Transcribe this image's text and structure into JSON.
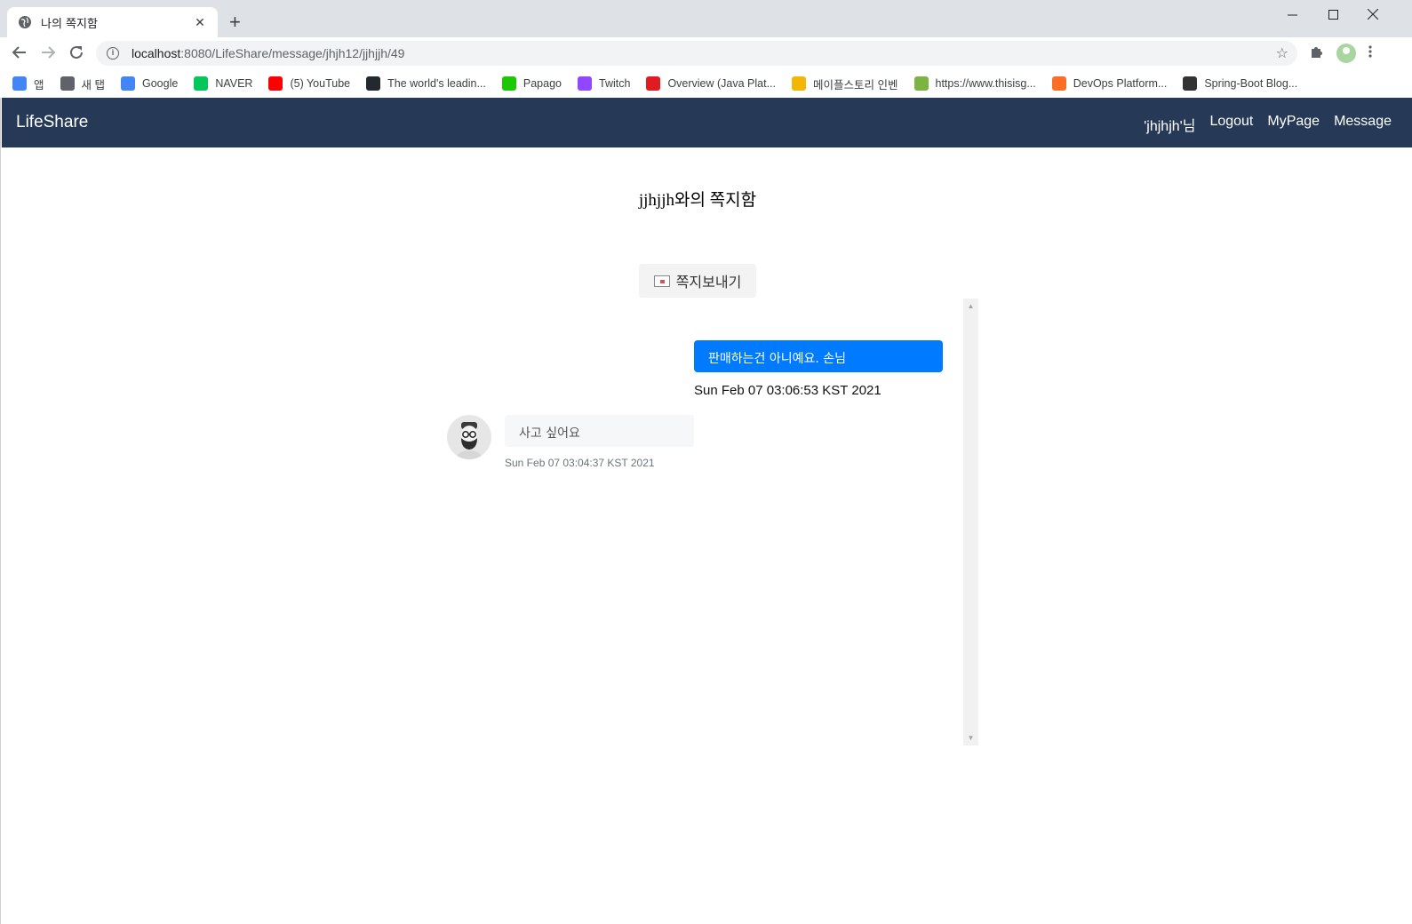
{
  "browser": {
    "tab_title": "나의 쪽지함",
    "tab_close": "✕",
    "new_tab": "+",
    "url_host": "localhost",
    "url_path": ":8080/LifeShare/message/jhjh12/jjhjjh/49",
    "bookmarks": [
      {
        "label": "앱",
        "icon": "apps-grid-icon",
        "color": "#4285f4"
      },
      {
        "label": "새 탭",
        "icon": "globe-icon",
        "color": "#5f6368"
      },
      {
        "label": "Google",
        "icon": "google-icon",
        "color": "#4285f4"
      },
      {
        "label": "NAVER",
        "icon": "naver-icon",
        "color": "#03c75a"
      },
      {
        "label": "(5) YouTube",
        "icon": "youtube-icon",
        "color": "#ff0000"
      },
      {
        "label": "The world's leadin...",
        "icon": "github-icon",
        "color": "#24292e"
      },
      {
        "label": "Papago",
        "icon": "papago-icon",
        "color": "#1ec800"
      },
      {
        "label": "Twitch",
        "icon": "twitch-icon",
        "color": "#9146ff"
      },
      {
        "label": "Overview (Java Plat...",
        "icon": "oracle-icon",
        "color": "#e11b22"
      },
      {
        "label": "메이플스토리 인벤",
        "icon": "inven-icon",
        "color": "#f2b705"
      },
      {
        "label": "https://www.thisisg...",
        "icon": "puzzle-icon",
        "color": "#7cb342"
      },
      {
        "label": "DevOps Platform...",
        "icon": "gitlab-icon",
        "color": "#fc6d26"
      },
      {
        "label": "Spring-Boot Blog...",
        "icon": "dots-icon",
        "color": "#333333"
      }
    ]
  },
  "nav": {
    "brand": "LifeShare",
    "user": "'jhjhjh'님",
    "logout": "Logout",
    "mypage": "MyPage",
    "message": "Message",
    "bg_color": "#263a57"
  },
  "main": {
    "heading": "jjhjjh와의 쪽지함",
    "send_button": "쪽지보내기"
  },
  "messages": {
    "sent": {
      "text": "판매하는건 아니예요. 손님",
      "time": "Sun Feb 07 03:06:53 KST 2021",
      "color": "#007bff"
    },
    "received": {
      "text": "사고 싶어요",
      "time": "Sun Feb 07 03:04:37 KST 2021"
    }
  }
}
